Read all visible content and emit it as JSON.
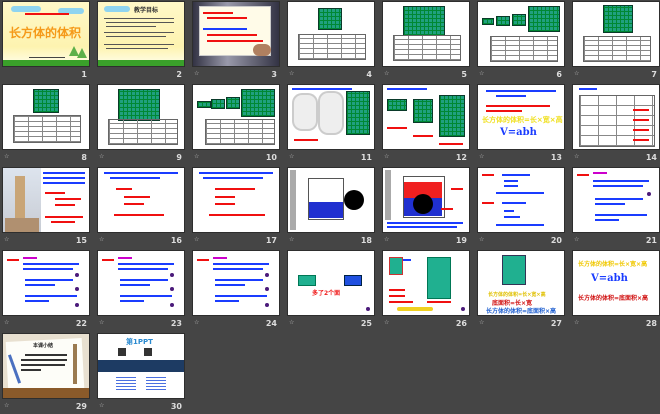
{
  "slides": [
    {
      "number": "1",
      "title": "长方体的体积"
    },
    {
      "number": "2",
      "title": "教学目标"
    },
    {
      "number": "3"
    },
    {
      "number": "4"
    },
    {
      "number": "5"
    },
    {
      "number": "6"
    },
    {
      "number": "7"
    },
    {
      "number": "8"
    },
    {
      "number": "9"
    },
    {
      "number": "10"
    },
    {
      "number": "11"
    },
    {
      "number": "12"
    },
    {
      "number": "13",
      "formula": "V=abh",
      "text": "长方体的体积=长×宽×高"
    },
    {
      "number": "14"
    },
    {
      "number": "15"
    },
    {
      "number": "16"
    },
    {
      "number": "17"
    },
    {
      "number": "18"
    },
    {
      "number": "19"
    },
    {
      "number": "20"
    },
    {
      "number": "21"
    },
    {
      "number": "22"
    },
    {
      "number": "23"
    },
    {
      "number": "24"
    },
    {
      "number": "25",
      "text": "多了2个面"
    },
    {
      "number": "26"
    },
    {
      "number": "27",
      "text1": "长方体的体积=长×宽×高",
      "text2": "底面积=长×宽",
      "text3": "长方体的体积=底面积×高"
    },
    {
      "number": "28",
      "text1": "长方体的体积=长×宽×高",
      "formula": "V=abh",
      "text2": "长方体的体积=底面积×高"
    },
    {
      "number": "29",
      "title": "本课小结"
    },
    {
      "number": "30",
      "logo": "第1PPT"
    }
  ],
  "colors": {
    "background": "#454545",
    "accent_blue": "#1a3cff",
    "accent_red": "#f01010",
    "cube_green": "#20a080"
  }
}
